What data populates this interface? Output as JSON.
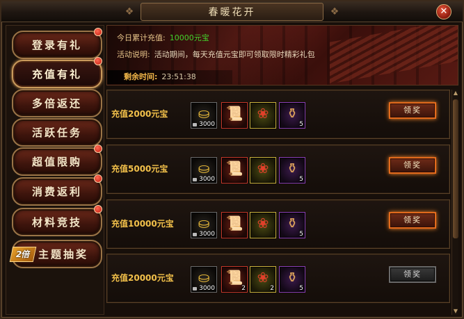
{
  "window": {
    "title": "春暖花开"
  },
  "sidebar": {
    "items": [
      {
        "label": "登录有礼",
        "active": false,
        "notify": true
      },
      {
        "label": "充值有礼",
        "active": true,
        "notify": true
      },
      {
        "label": "多倍返还",
        "active": false,
        "notify": false
      },
      {
        "label": "活跃任务",
        "active": false,
        "notify": false
      },
      {
        "label": "超值限购",
        "active": false,
        "notify": true
      },
      {
        "label": "消费返利",
        "active": false,
        "notify": true
      },
      {
        "label": "材料竞技",
        "active": false,
        "notify": true
      },
      {
        "label": "主题抽奖",
        "active": false,
        "notify": false
      }
    ],
    "badge": "2倍"
  },
  "banner": {
    "total_label": "今日累计充值:",
    "total_value": "10000元宝",
    "desc_label": "活动说明:",
    "desc_text": "活动期间，每天充值元宝即可领取限时精彩礼包",
    "timer_label": "剩余时间:",
    "timer_value": "23:51:38"
  },
  "rewards": [
    {
      "label": "充值2000元宝",
      "claim": "领奖",
      "claimable": true,
      "items": [
        {
          "icon": "gold-ingot-icon",
          "count": "3000"
        },
        {
          "icon": "scroll-icon",
          "count": ""
        },
        {
          "icon": "red-pouch-icon",
          "count": ""
        },
        {
          "icon": "purple-bag-icon",
          "count": "5"
        }
      ]
    },
    {
      "label": "充值5000元宝",
      "claim": "领奖",
      "claimable": true,
      "items": [
        {
          "icon": "gold-ingot-icon",
          "count": "3000"
        },
        {
          "icon": "scroll-icon",
          "count": ""
        },
        {
          "icon": "red-pouch-icon",
          "count": ""
        },
        {
          "icon": "purple-bag-icon",
          "count": "5"
        }
      ]
    },
    {
      "label": "充值10000元宝",
      "claim": "领奖",
      "claimable": true,
      "items": [
        {
          "icon": "gold-ingot-icon",
          "count": "3000"
        },
        {
          "icon": "scroll-icon",
          "count": ""
        },
        {
          "icon": "red-pouch-icon",
          "count": ""
        },
        {
          "icon": "purple-bag-icon",
          "count": "5"
        }
      ]
    },
    {
      "label": "充值20000元宝",
      "claim": "领奖",
      "claimable": false,
      "items": [
        {
          "icon": "gold-ingot-icon",
          "count": "3000"
        },
        {
          "icon": "scroll-icon",
          "count": "2"
        },
        {
          "icon": "red-pouch-icon",
          "count": "2"
        },
        {
          "icon": "purple-bag-icon",
          "count": "5"
        }
      ]
    }
  ],
  "colors": {
    "accent_gold": "#f2c04a",
    "value_green": "#43d12b",
    "claim_glow": "#e36a1c"
  }
}
